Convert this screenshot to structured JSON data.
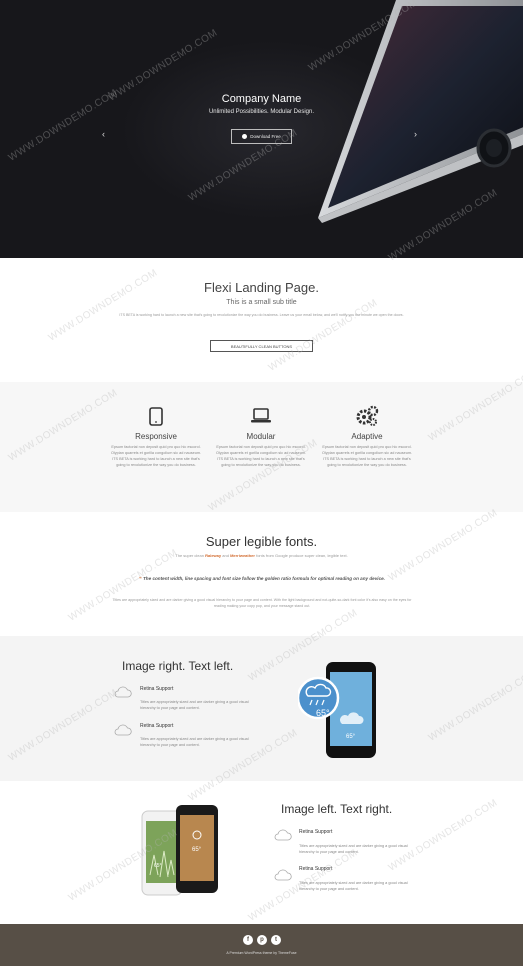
{
  "hero": {
    "title": "Company Name",
    "subtitle": "Unlimited Possibilities. Modular Design.",
    "button_label": "Download Free",
    "prev_arrow": "‹",
    "next_arrow": "›"
  },
  "intro": {
    "title": "Flexi Landing Page.",
    "subtitle": "This is a small sub title",
    "text": "ITS BETA is working hard to launch a new site that's going to revolutionize the way you do business. Leave us your email below, and we'll notify you the minute we open the doors.",
    "button_label": "BEAUTIFULLY CLEAN BUTTONS"
  },
  "features": [
    {
      "icon": "tablet-icon",
      "title": "Responsive",
      "text": "Epsum factorial non deposit quid pro quo hic escorol. Olypian quarrels et gorilla congolium sic ad nauseum. ITS BETA is working hard to launch a new site that's going to revolutionize the way you do business."
    },
    {
      "icon": "laptop-icon",
      "title": "Modular",
      "text": "Epsum factorial non deposit quid pro quo hic escorol. Olypian quarrels et gorilla congolium sic ad nauseum. ITS BETA is working hard to launch a new site that's going to revolutionize the way you do business."
    },
    {
      "icon": "gears-icon",
      "title": "Adaptive",
      "text": "Epsum factorial non deposit quid pro quo hic escorol. Olypian quarrels et gorilla congolium sic ad nauseum. ITS BETA is working hard to launch a new site that's going to revolutionize the way you do business."
    }
  ],
  "fonts": {
    "title": "Super legible fonts.",
    "sub_prefix": "The super clean",
    "font1": "Raleway",
    "sub_and": "and",
    "font2": "Merriweather",
    "sub_suffix": "fonts from Google produce super clean, legible text.",
    "quote": "The content width, line spacing and font size follow the golden ratio formula for optimal reading on any device.",
    "body": "Titles are appropriately sized and are darker giving a good visual hierarchy to your page and content. With the light background and not-quite-so-dark font color it's also easy on the eyes for reading making your copy pop, and your message stand out."
  },
  "image_right": {
    "title": "Image right. Text left.",
    "items": [
      {
        "icon": "cloud-icon",
        "title": "Retina Support",
        "text": "Titles are appropriately sized and are darker giving a good visual hierarchy to your page and content."
      },
      {
        "icon": "cloud-icon",
        "title": "Retina Support",
        "text": "Titles are appropriately sized and are darker giving a good visual hierarchy to your page and content."
      }
    ],
    "phone_temp": "65°",
    "phone_temp_small": "65°"
  },
  "image_left": {
    "title": "Image left. Text right.",
    "items": [
      {
        "icon": "cloud-icon",
        "title": "Retina Support",
        "text": "Titles are appropriately sized and are darker giving a good visual hierarchy to your page and content."
      },
      {
        "icon": "cloud-icon",
        "title": "Retina Support",
        "text": "Titles are appropriately sized and are darker giving a good visual hierarchy to your page and content."
      }
    ],
    "phone_temp": "65°",
    "phone_temp_small": "65°"
  },
  "footer": {
    "social": [
      {
        "icon": "facebook-icon",
        "glyph": "f"
      },
      {
        "icon": "pinterest-icon",
        "glyph": "p"
      },
      {
        "icon": "twitter-icon",
        "glyph": "t"
      }
    ],
    "text": "A Premium WordPress theme by ThemeFuse"
  },
  "watermark": "WWW.DOWNDEMO.COM",
  "colors": {
    "hero_bg": "#17171b",
    "accent": "#d26b2f",
    "footer_bg": "#574f46",
    "section_alt_bg": "#f7f7f7"
  }
}
